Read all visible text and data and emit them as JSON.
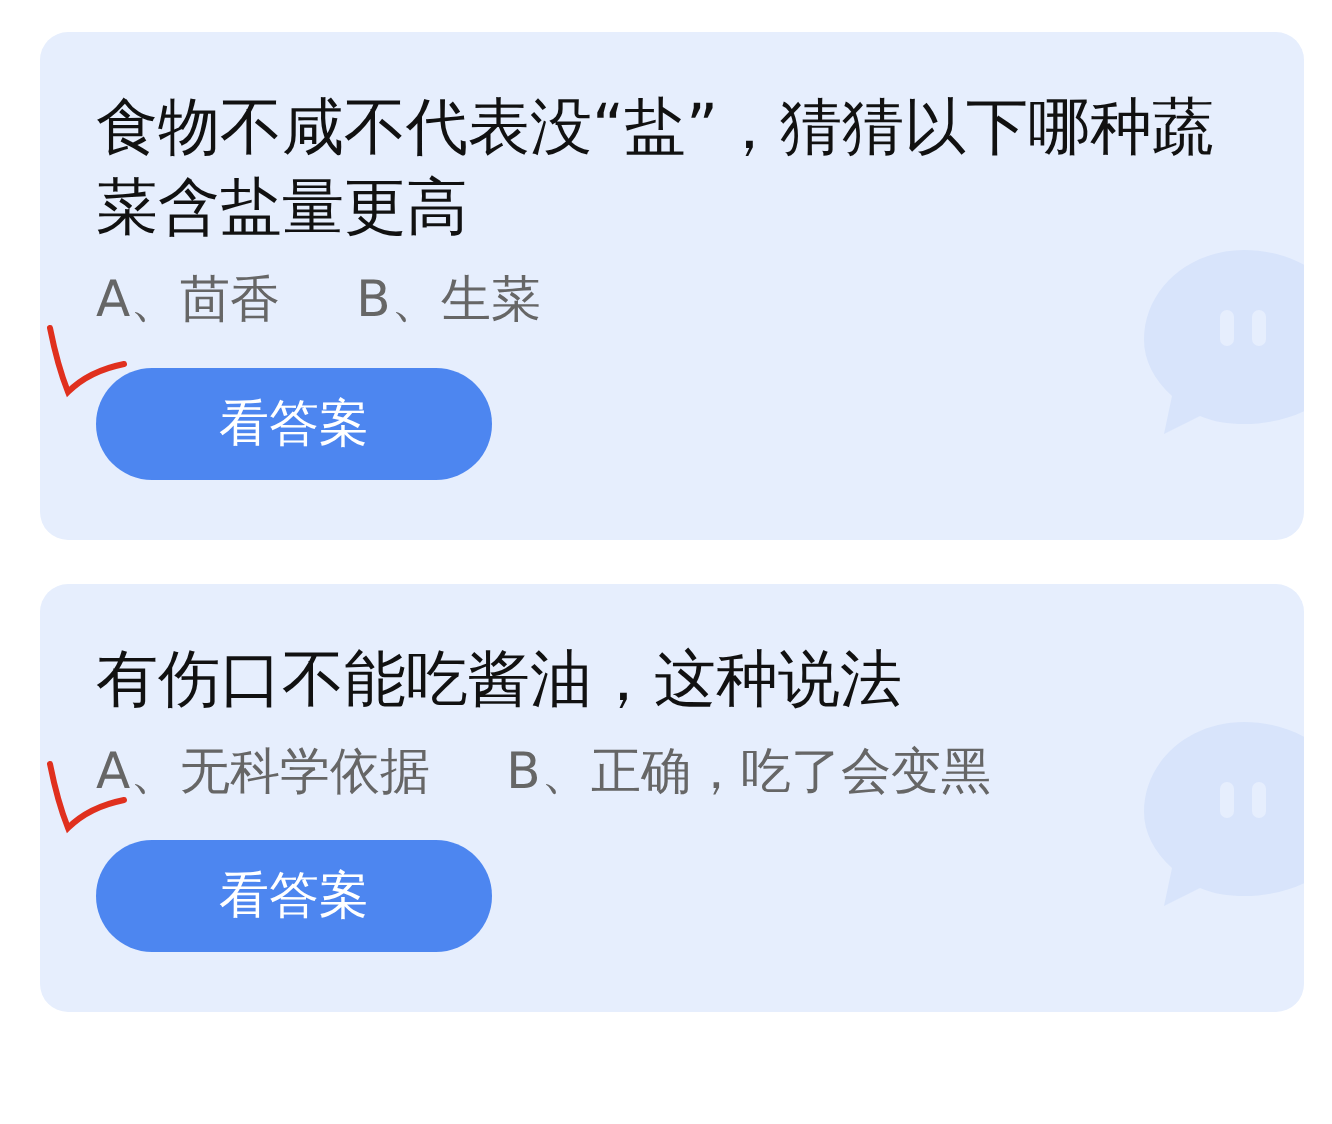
{
  "cards": [
    {
      "title": "食物不咸不代表没“盐”，猜猜以下哪种蔬菜含盐量更高",
      "options": [
        "A、茴香",
        "B、生菜"
      ],
      "check_mark": true,
      "button": "看答案"
    },
    {
      "title": "有伤口不能吃酱油，这种说法",
      "options": [
        "A、无科学依据",
        "B、正确，吃了会变黑"
      ],
      "check_mark": true,
      "button": "看答案"
    }
  ]
}
